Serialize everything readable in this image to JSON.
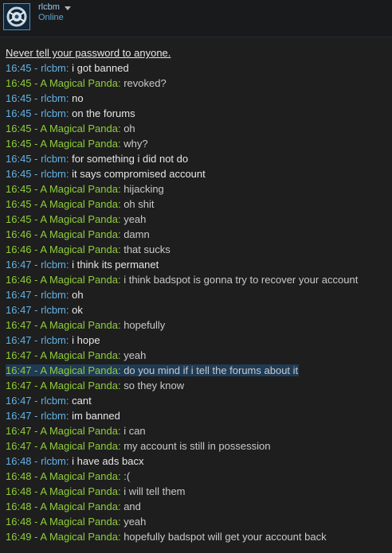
{
  "user": {
    "name": "rlcbm",
    "status": "Online"
  },
  "colors": {
    "self": "#62b2e4",
    "friend": "#8fcd3c",
    "highlight": "#1f3b56"
  },
  "chat": {
    "warning": "Never tell your password to anyone.",
    "messages": [
      {
        "time": "16:45",
        "sender": "rlcbm",
        "who": "self",
        "text": "i got banned"
      },
      {
        "time": "16:45",
        "sender": "A Magical Panda",
        "who": "friend",
        "text": "revoked?"
      },
      {
        "time": "16:45",
        "sender": "rlcbm",
        "who": "self",
        "text": "no"
      },
      {
        "time": "16:45",
        "sender": "rlcbm",
        "who": "self",
        "text": "on the forums"
      },
      {
        "time": "16:45",
        "sender": "A Magical Panda",
        "who": "friend",
        "text": "oh"
      },
      {
        "time": "16:45",
        "sender": "A Magical Panda",
        "who": "friend",
        "text": "why?"
      },
      {
        "time": "16:45",
        "sender": "rlcbm",
        "who": "self",
        "text": "for something i did not do"
      },
      {
        "time": "16:45",
        "sender": "rlcbm",
        "who": "self",
        "text": "it says compromised account"
      },
      {
        "time": "16:45",
        "sender": "A Magical Panda",
        "who": "friend",
        "text": "hijacking"
      },
      {
        "time": "16:45",
        "sender": "A Magical Panda",
        "who": "friend",
        "text": "oh shit"
      },
      {
        "time": "16:45",
        "sender": "A Magical Panda",
        "who": "friend",
        "text": "yeah"
      },
      {
        "time": "16:46",
        "sender": "A Magical Panda",
        "who": "friend",
        "text": "damn"
      },
      {
        "time": "16:46",
        "sender": "A Magical Panda",
        "who": "friend",
        "text": "that sucks"
      },
      {
        "time": "16:47",
        "sender": "rlcbm",
        "who": "self",
        "text": "i think its permanet"
      },
      {
        "time": "16:46",
        "sender": "A Magical Panda",
        "who": "friend",
        "text": "i think badspot is gonna try to recover your account"
      },
      {
        "time": "16:47",
        "sender": "rlcbm",
        "who": "self",
        "text": "oh"
      },
      {
        "time": "16:47",
        "sender": "rlcbm",
        "who": "self",
        "text": "ok"
      },
      {
        "time": "16:47",
        "sender": "A Magical Panda",
        "who": "friend",
        "text": "hopefully"
      },
      {
        "time": "16:47",
        "sender": "rlcbm",
        "who": "self",
        "text": "i hope"
      },
      {
        "time": "16:47",
        "sender": "A Magical Panda",
        "who": "friend",
        "text": "yeah"
      },
      {
        "time": "16:47",
        "sender": "A Magical Panda",
        "who": "friend",
        "text": "do you mind if i tell the forums about it",
        "highlight": true
      },
      {
        "time": "16:47",
        "sender": "A Magical Panda",
        "who": "friend",
        "text": "so they know"
      },
      {
        "time": "16:47",
        "sender": "rlcbm",
        "who": "self",
        "text": "cant"
      },
      {
        "time": "16:47",
        "sender": "rlcbm",
        "who": "self",
        "text": "im banned"
      },
      {
        "time": "16:47",
        "sender": "A Magical Panda",
        "who": "friend",
        "text": "i can"
      },
      {
        "time": "16:47",
        "sender": "A Magical Panda",
        "who": "friend",
        "text": "my account is still in possession"
      },
      {
        "time": "16:48",
        "sender": "rlcbm",
        "who": "self",
        "text": "i have ads bacx"
      },
      {
        "time": "16:48",
        "sender": "A Magical Panda",
        "who": "friend",
        "text": ":("
      },
      {
        "time": "16:48",
        "sender": "A Magical Panda",
        "who": "friend",
        "text": "i will tell them"
      },
      {
        "time": "16:48",
        "sender": "A Magical Panda",
        "who": "friend",
        "text": "and"
      },
      {
        "time": "16:48",
        "sender": "A Magical Panda",
        "who": "friend",
        "text": "yeah"
      },
      {
        "time": "16:49",
        "sender": "A Magical Panda",
        "who": "friend",
        "text": "hopefully badspot will get your account back"
      }
    ]
  }
}
